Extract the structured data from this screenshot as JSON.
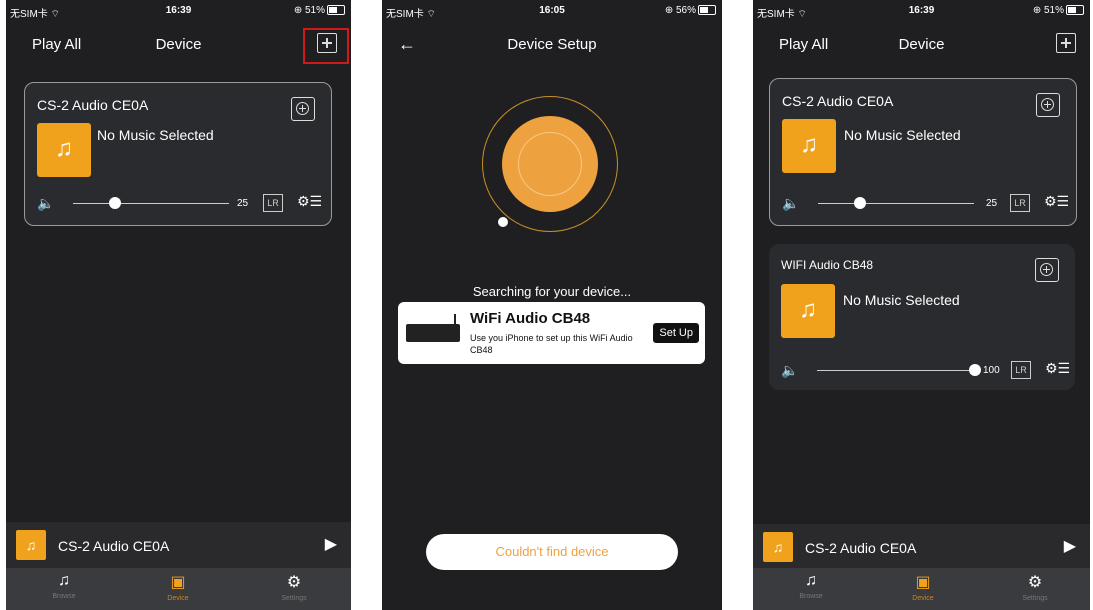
{
  "screens": [
    {
      "status": {
        "carrier": "无SIM卡 ⌔",
        "time": "16:39",
        "battery": "⊕ 51%"
      },
      "nav": {
        "left": "Play All",
        "title": "Device"
      },
      "cards": [
        {
          "name": "CS-2 Audio CE0A",
          "music": "No Music Selected",
          "volume": "25",
          "lr": "LR"
        }
      ],
      "now_playing": "CS-2 Audio CE0A",
      "tabs": [
        "Browse",
        "Device",
        "Settings"
      ]
    },
    {
      "status": {
        "carrier": "无SIM卡 ⌔",
        "time": "16:05",
        "battery": "⊕ 56%"
      },
      "nav": {
        "back": "←",
        "title": "Device Setup"
      },
      "searching": "Searching for your device...",
      "device": {
        "name": "WiFi Audio CB48",
        "desc": "Use you iPhone to set up this WiFi Audio CB48",
        "button": "Set Up"
      },
      "not_found": "Couldn't find device"
    },
    {
      "status": {
        "carrier": "无SIM卡 ⌔",
        "time": "16:39",
        "battery": "⊕ 51%"
      },
      "nav": {
        "left": "Play All",
        "title": "Device"
      },
      "cards": [
        {
          "name": "CS-2 Audio CE0A",
          "music": "No Music Selected",
          "volume": "25",
          "lr": "LR"
        },
        {
          "name": "WIFI Audio CB48",
          "music": "No Music Selected",
          "volume": "100",
          "lr": "LR"
        }
      ],
      "now_playing": "CS-2 Audio CE0A",
      "tabs": [
        "Browse",
        "Device",
        "Settings"
      ]
    }
  ],
  "accent_color": "#f0a21c",
  "highlight_color": "#d0191b"
}
